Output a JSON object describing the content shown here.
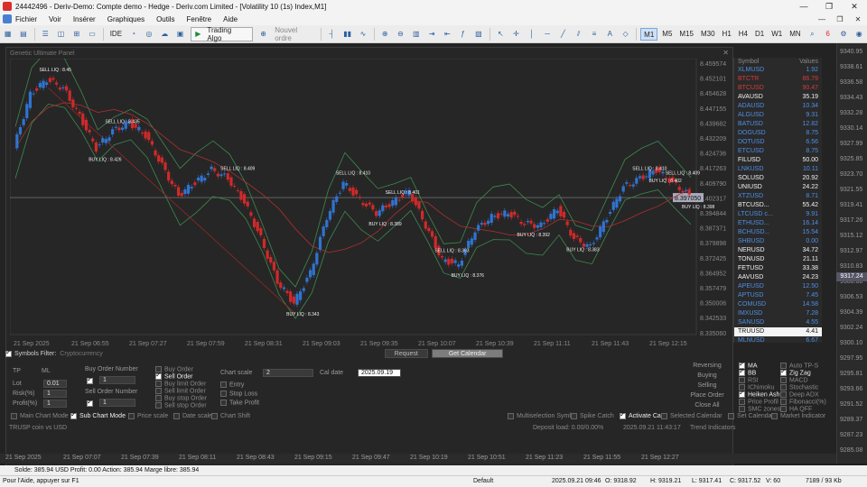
{
  "window": {
    "title": "24442496 - Deriv-Demo: Compte demo - Hedge - Deriv.com Limited - [Volatility 10 (1s) Index,M1]"
  },
  "menu": {
    "items": [
      "Fichier",
      "Voir",
      "Insérer",
      "Graphiques",
      "Outils",
      "Fenêtre",
      "Aide"
    ]
  },
  "toolbar": {
    "ide_label": "IDE",
    "algo_label": "Trading Algo",
    "new_order_label": "Nouvel ordre",
    "timeframes": [
      "M1",
      "M5",
      "M15",
      "M30",
      "H1",
      "H4",
      "D1",
      "W1",
      "MN"
    ],
    "active_timeframe": "M1",
    "notif_count": "6"
  },
  "panel": {
    "title": "Genetic Ultimate Panel",
    "symbol_desc": "TRUSP coin vs USD"
  },
  "chart_data": {
    "type": "line",
    "title": "",
    "price_axis_labels": [
      "8.459574",
      "8.452101",
      "8.454628",
      "8.447155",
      "8.439682",
      "8.432209",
      "8.424736",
      "8.417263",
      "8.409790",
      "8.402317",
      "8.394844",
      "8.387371",
      "8.379898",
      "8.372425",
      "8.364952",
      "8.357479",
      "8.350006",
      "8.342533",
      "8.335060"
    ],
    "time_axis_labels": [
      "21 Sep 2025",
      "21 Sep 06:55",
      "21 Sep 07:27",
      "21 Sep 07:59",
      "21 Sep 08:31",
      "21 Sep 09:03",
      "21 Sep 09:35",
      "21 Sep 10:07",
      "21 Sep 10:39",
      "21 Sep 11:11",
      "21 Sep 11:43",
      "21 Sep 12:15"
    ],
    "current_price": "8.397050",
    "series": [
      {
        "color": "#d03030",
        "values": [
          8.42,
          8.445,
          8.452,
          8.448,
          8.435,
          8.42,
          8.428,
          8.432,
          8.426,
          8.412,
          8.398,
          8.404,
          8.41,
          8.406,
          8.395,
          8.378,
          8.358,
          8.348,
          8.362,
          8.388,
          8.404,
          8.396,
          8.39,
          8.395,
          8.4,
          8.384,
          8.368,
          8.366,
          8.382,
          8.388,
          8.39,
          8.385,
          8.384,
          8.392,
          8.378,
          8.374,
          8.388,
          8.402,
          8.406,
          8.41,
          8.404,
          8.398
        ]
      }
    ],
    "labels": [
      {
        "text": "SELL LIQ : 8.45",
        "i": 2
      },
      {
        "text": "BUY LIQ : 8.426",
        "i": 5
      },
      {
        "text": "SELL LIQ : 8.435",
        "i": 6
      },
      {
        "text": "SELL LIQ : 8.409",
        "i": 13
      },
      {
        "text": "BUY LIQ : 8.343",
        "i": 17
      },
      {
        "text": "SELL LIQ : 8.410",
        "i": 20
      },
      {
        "text": "SELL LIQ : 8.401",
        "i": 23
      },
      {
        "text": "SELL LIQ : 8.393",
        "i": 26
      },
      {
        "text": "BUY LIQ : 8.389",
        "i": 22
      },
      {
        "text": "BUY LIQ : 8.376",
        "i": 27
      },
      {
        "text": "BUY LIQ : 8.392",
        "i": 31
      },
      {
        "text": "BUY LIQ : 8.383",
        "i": 34
      },
      {
        "text": "SELL LIQ : 8.410",
        "i": 38
      },
      {
        "text": "SELL LIQ : 8.409",
        "i": 40
      },
      {
        "text": "BUY LIQ : 8.402",
        "i": 39
      },
      {
        "text": "BUY LIQ : 8.398",
        "i": 41
      }
    ]
  },
  "right_axis": {
    "ticks": [
      "9340.95",
      "9338.61",
      "9336.58",
      "9334.43",
      "9332.28",
      "9330.14",
      "9327.99",
      "9325.85",
      "9323.70",
      "9321.55",
      "9319.41",
      "9317.26",
      "9315.12",
      "9312.97",
      "9310.83",
      "9308.68",
      "9306.53",
      "9304.39",
      "9302.24",
      "9300.10",
      "9297.95",
      "9295.81",
      "9293.66",
      "9291.52",
      "9289.37",
      "9287.23",
      "9285.08"
    ],
    "price_tag": "9317.24"
  },
  "symbols": {
    "header_symbol": "Symbol",
    "header_values": "Values",
    "rows": [
      {
        "name": "XLMUSD",
        "value": "1.92",
        "nc": "blue",
        "vc": "blue"
      },
      {
        "name": "BTCTR",
        "value": "86.79",
        "nc": "red",
        "vc": "red"
      },
      {
        "name": "BTCUSD",
        "value": "90.47",
        "nc": "red",
        "vc": "red"
      },
      {
        "name": "AVAUSD",
        "value": "35.19",
        "nc": "white",
        "vc": "white"
      },
      {
        "name": "ADAUSD",
        "value": "10.34",
        "nc": "blue",
        "vc": "blue"
      },
      {
        "name": "ALGUSD",
        "value": "9.31",
        "nc": "blue",
        "vc": "blue"
      },
      {
        "name": "BATUSD",
        "value": "12.82",
        "nc": "blue",
        "vc": "blue"
      },
      {
        "name": "DOGUSD",
        "value": "8.75",
        "nc": "blue",
        "vc": "blue"
      },
      {
        "name": "DOTUSD",
        "value": "6.56",
        "nc": "blue",
        "vc": "blue"
      },
      {
        "name": "ETCUSD",
        "value": "8.75",
        "nc": "blue",
        "vc": "blue"
      },
      {
        "name": "FILUSD",
        "value": "50.00",
        "nc": "white",
        "vc": "white"
      },
      {
        "name": "LNKUSD",
        "value": "10.11",
        "nc": "blue",
        "vc": "blue"
      },
      {
        "name": "SOLUSD",
        "value": "20.92",
        "nc": "white",
        "vc": "white"
      },
      {
        "name": "UNIUSD",
        "value": "24.22",
        "nc": "white",
        "vc": "white"
      },
      {
        "name": "XTZUSD",
        "value": "8.71",
        "nc": "blue",
        "vc": "blue"
      },
      {
        "name": "BTCUSD...",
        "value": "55.42",
        "nc": "white",
        "vc": "white"
      },
      {
        "name": "LTCUSD c...",
        "value": "9.91",
        "nc": "blue",
        "vc": "blue"
      },
      {
        "name": "ETHUSD...",
        "value": "16.14",
        "nc": "blue",
        "vc": "blue"
      },
      {
        "name": "BCHUSD...",
        "value": "15.54",
        "nc": "blue",
        "vc": "blue"
      },
      {
        "name": "SHBUSD",
        "value": "0.00",
        "nc": "blue",
        "vc": "blue"
      },
      {
        "name": "NERUSD",
        "value": "34.72",
        "nc": "white",
        "vc": "white"
      },
      {
        "name": "TONUSD",
        "value": "21.11",
        "nc": "white",
        "vc": "white"
      },
      {
        "name": "FETUSD",
        "value": "33.38",
        "nc": "white",
        "vc": "white"
      },
      {
        "name": "AAVUSD",
        "value": "24.23",
        "nc": "white",
        "vc": "white"
      },
      {
        "name": "APEUSD",
        "value": "12.50",
        "nc": "blue",
        "vc": "blue"
      },
      {
        "name": "APTUSD",
        "value": "7.45",
        "nc": "blue",
        "vc": "blue"
      },
      {
        "name": "COMUSD",
        "value": "14.58",
        "nc": "blue",
        "vc": "blue"
      },
      {
        "name": "IMXUSD",
        "value": "7.28",
        "nc": "blue",
        "vc": "blue"
      },
      {
        "name": "SANUSD",
        "value": "4.55",
        "nc": "blue",
        "vc": "blue"
      },
      {
        "name": "TRUUSD",
        "value": "4.41",
        "nc": "white",
        "vc": "white",
        "selected": true
      },
      {
        "name": "MLNUSD",
        "value": "6.67",
        "nc": "blue",
        "vc": "blue"
      }
    ]
  },
  "filter": {
    "label": "Symbols Filter:",
    "value": "Cryptocurrency",
    "request_label": "Request",
    "calendar_label": "Get Calendar"
  },
  "controls": {
    "tp": "TP",
    "ml": "ML",
    "lot_label": "Lot",
    "lot_value": "0.01",
    "risk_label": "Risk(%)",
    "risk_value": "1",
    "profit_label": "Profit(%)",
    "profit_value": "1",
    "buy_order_number": "Buy Order Number",
    "buy_order_value": "1",
    "sell_order_number": "Sell Order Number",
    "sell_order_value": "1",
    "order_types": [
      "Buy Order",
      "Sell Order",
      "Buy limit Order",
      "Sell limit Order",
      "Buy stop Order",
      "Sell stop Order"
    ],
    "chart_scale": "Chart scale",
    "chart_scale_value": "2",
    "entry": "Entry",
    "stop_loss": "Stop Loss",
    "take_profit": "Take Profit",
    "cal_date": "Cal date",
    "cal_date_value": "2025.09.19",
    "actions": [
      "Reversing",
      "Buying",
      "Selling",
      "Place Order",
      "Close All"
    ],
    "indicators_left": [
      "MA",
      "BB",
      "RSI",
      "IChimoku",
      "Heiken Ash",
      "Price Profil",
      "SMC zones"
    ],
    "indicators_right": [
      "Auto TP-S",
      "Zig Zag",
      "MACD",
      "Stochastic",
      "Deep ADX",
      "Fibonacci(%)",
      "HA QFF"
    ]
  },
  "options": {
    "items": [
      "Main Chart Mode",
      "Sub Chart Mode",
      "Price scale",
      "Date scale",
      "Chart Shift"
    ],
    "right_items": [
      "Multiselection Symb",
      "Spike Catch",
      "Activate Ca",
      "Selected Calendar",
      "Set Calendar",
      "Market Indicator"
    ]
  },
  "inner_status": {
    "deposit": "Deposit load: 0.00/0.00%",
    "datetime": "2025.09.21 11:43:17",
    "trend": "Trend Indicators"
  },
  "bottom_axis": {
    "labels": [
      "21 Sep 2025",
      "21 Sep 07:07",
      "21 Sep 07:39",
      "21 Sep 08:11",
      "21 Sep 08:43",
      "21 Sep 09:15",
      "21 Sep 09:47",
      "21 Sep 10:19",
      "21 Sep 10:51",
      "21 Sep 11:23",
      "21 Sep 11:55",
      "21 Sep 12:27"
    ]
  },
  "account": {
    "text": "Solde: 385.94 USD  Profit: 0.00  Action: 385.94  Marge libre: 385.94"
  },
  "statusbar": {
    "help": "Pour l'Aide, appuyer sur F1",
    "profile": "Default",
    "time": "2025.09.21 09:46",
    "open": "O: 9318.92",
    "high": "H: 9319.21",
    "low": "L: 9317.41",
    "close": "C: 9317.52",
    "volume": "V: 60",
    "traffic": "7189 / 93 Kb"
  }
}
